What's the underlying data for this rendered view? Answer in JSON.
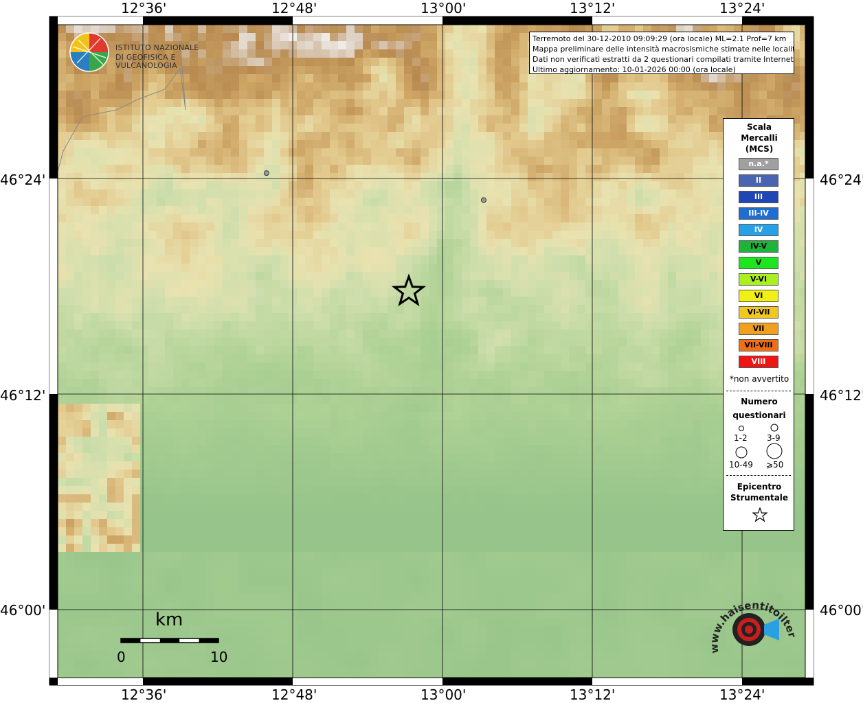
{
  "map": {
    "lon_labels": [
      "12°36'",
      "12°48'",
      "13°00'",
      "13°12'",
      "13°24'"
    ],
    "lat_labels": [
      "46°24'",
      "46°12'",
      "46°00'"
    ],
    "epicenter": {
      "lon": 12.955,
      "lat": 46.295
    },
    "locality_points": [
      {
        "lon": 12.765,
        "lat": 46.405
      },
      {
        "lon": 13.055,
        "lat": 46.38
      }
    ]
  },
  "info": {
    "line1": "Terremoto del 30-12-2010 09:09:29 (ora locale) ML=2.1 Prof=7 km",
    "line2": "Mappa preliminare delle intensità macrosismiche stimate nelle località",
    "line3": "Dati non verificati estratti da 2 questionari compilati tramite Internet.",
    "line4": "Ultimo aggiornamento: 10-01-2026 00:00 (ora locale)"
  },
  "logo": {
    "line1": "ISTITUTO NAZIONALE",
    "line2": "DI GEOFISICA E VULCANOLOGIA"
  },
  "legend": {
    "title1": "Scala",
    "title2": "Mercalli",
    "title3": "(MCS)",
    "items": [
      {
        "label": "n.a.*",
        "color": "#a0a0a0",
        "text": "#ffffff"
      },
      {
        "label": "II",
        "color": "#4a64b4",
        "text": "#ffffff"
      },
      {
        "label": "III",
        "color": "#1e46b4",
        "text": "#ffffff"
      },
      {
        "label": "III-IV",
        "color": "#1e6ed2",
        "text": "#ffffff"
      },
      {
        "label": "IV",
        "color": "#28a0e6",
        "text": "#ffffff"
      },
      {
        "label": "IV-V",
        "color": "#1eb43c",
        "text": "#000000"
      },
      {
        "label": "V",
        "color": "#1ee61e",
        "text": "#000000"
      },
      {
        "label": "V-VI",
        "color": "#aaf01e",
        "text": "#000000"
      },
      {
        "label": "VI",
        "color": "#f0f014",
        "text": "#000000"
      },
      {
        "label": "VI-VII",
        "color": "#f0c81e",
        "text": "#000000"
      },
      {
        "label": "VII",
        "color": "#f0a01e",
        "text": "#000000"
      },
      {
        "label": "VII-VIII",
        "color": "#f06e14",
        "text": "#000000"
      },
      {
        "label": "VIII",
        "color": "#f01414",
        "text": "#ffffff"
      }
    ],
    "note": "*non avvertito",
    "questionnaire_title1": "Numero",
    "questionnaire_title2": "questionari",
    "q_labels": [
      "1-2",
      "3-9",
      "10-49",
      "⩾50"
    ],
    "epicenter_title1": "Epicentro",
    "epicenter_title2": "Strumentale"
  },
  "scale": {
    "unit": "km",
    "min": "0",
    "max": "10"
  },
  "badge": {
    "text": "www.haisentitoilterremoto.it"
  }
}
